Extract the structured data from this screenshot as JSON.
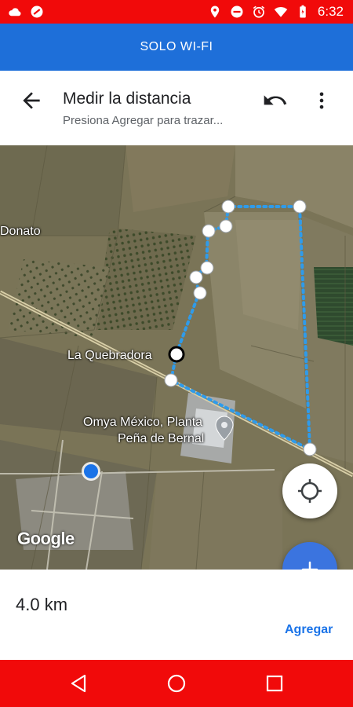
{
  "status_bar": {
    "time": "6:32",
    "left_icons": [
      "cloud-icon",
      "no-entry-icon"
    ],
    "right_icons": [
      "location-pin-icon",
      "do-not-disturb-icon",
      "alarm-icon",
      "wifi-icon",
      "battery-icon"
    ]
  },
  "banner": {
    "text": "SOLO WI-FI"
  },
  "header": {
    "title": "Medir la distancia",
    "subtitle": "Presiona Agregar para trazar...",
    "back_icon": "arrow-back-icon",
    "undo_icon": "undo-icon",
    "more_icon": "more-vert-icon"
  },
  "map": {
    "labels": {
      "donato": "Donato",
      "la_quebradora": "La Quebradora",
      "omya_line1": "Omya México, Planta",
      "omya_line2": "Peña de Bernal"
    },
    "logo": "Google",
    "path_color": "#2f9bea",
    "my_location_color": "#1a73e8"
  },
  "bottom": {
    "distance": "4.0 km",
    "add_label": "Agregar"
  },
  "colors": {
    "status_bar": "#f10a0a",
    "banner": "#1e6fd9",
    "fab": "#3b74df",
    "link": "#1a73e8"
  }
}
